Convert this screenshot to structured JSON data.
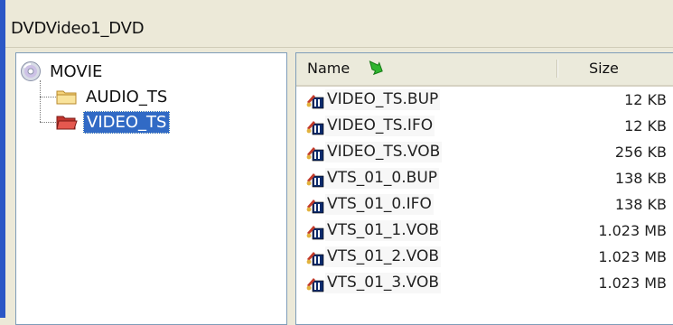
{
  "window": {
    "title": "DVDVideo1_DVD"
  },
  "tree": {
    "root": {
      "label": "MOVIE",
      "icon": "dvd-disc-icon"
    },
    "children": [
      {
        "label": "AUDIO_TS",
        "icon": "folder-closed-icon",
        "selected": false
      },
      {
        "label": "VIDEO_TS",
        "icon": "folder-open-icon",
        "selected": true
      }
    ]
  },
  "list": {
    "columns": {
      "name": "Name",
      "size": "Size"
    },
    "sort_icon": "green-sort-arrow-icon",
    "rows": [
      {
        "name": "VIDEO_TS.BUP",
        "size": "12 KB"
      },
      {
        "name": "VIDEO_TS.IFO",
        "size": "12 KB"
      },
      {
        "name": "VIDEO_TS.VOB",
        "size": "256 KB"
      },
      {
        "name": "VTS_01_0.BUP",
        "size": "138 KB"
      },
      {
        "name": "VTS_01_0.IFO",
        "size": "138 KB"
      },
      {
        "name": "VTS_01_1.VOB",
        "size": "1.023 MB"
      },
      {
        "name": "VTS_01_2.VOB",
        "size": "1.023 MB"
      },
      {
        "name": "VTS_01_3.VOB",
        "size": "1.023 MB"
      }
    ]
  },
  "colors": {
    "selection": "#316ac5",
    "accent": "#2b57c6",
    "panel_border": "#7f9db9"
  }
}
